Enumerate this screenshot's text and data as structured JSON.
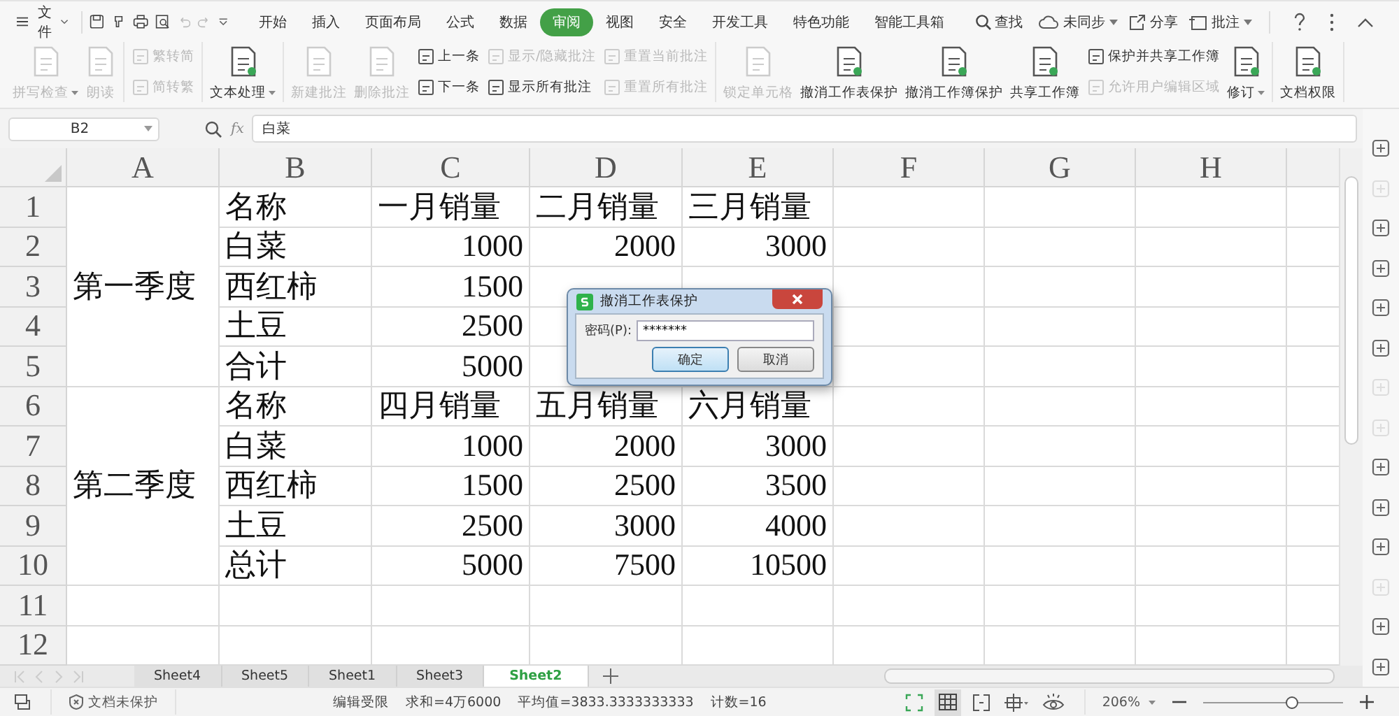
{
  "menu_bar": {
    "file": "文件",
    "tabs": [
      {
        "label": "开始",
        "selected": false
      },
      {
        "label": "插入",
        "selected": false
      },
      {
        "label": "页面布局",
        "selected": false
      },
      {
        "label": "公式",
        "selected": false
      },
      {
        "label": "数据",
        "selected": false
      },
      {
        "label": "审阅",
        "selected": true
      },
      {
        "label": "视图",
        "selected": false
      },
      {
        "label": "安全",
        "selected": false
      },
      {
        "label": "开发工具",
        "selected": false
      },
      {
        "label": "特色功能",
        "selected": false
      },
      {
        "label": "智能工具箱",
        "selected": false
      }
    ],
    "search": "查找",
    "sync": "未同步",
    "share": "分享",
    "comment": "批注"
  },
  "ribbon": [
    {
      "items": [
        {
          "kind": "big",
          "label": "拼写检查",
          "disabled": true,
          "dropdown": true
        },
        {
          "kind": "big",
          "label": "朗读",
          "disabled": true,
          "dropdown": false
        }
      ]
    },
    {
      "items": [
        {
          "kind": "stack",
          "items": [
            {
              "label": "繁转简",
              "disabled": true
            },
            {
              "label": "简转繁",
              "disabled": true
            }
          ]
        }
      ]
    },
    {
      "items": [
        {
          "kind": "big",
          "label": "文本处理",
          "disabled": false,
          "dropdown": true
        }
      ]
    },
    {
      "items": [
        {
          "kind": "big",
          "label": "新建批注",
          "disabled": true,
          "dropdown": false
        },
        {
          "kind": "big",
          "label": "删除批注",
          "disabled": true,
          "dropdown": false
        },
        {
          "kind": "stack",
          "items": [
            {
              "label": "上一条",
              "disabled": false
            },
            {
              "label": "下一条",
              "disabled": false
            }
          ]
        },
        {
          "kind": "stack",
          "items": [
            {
              "label": "显示/隐藏批注",
              "disabled": true
            },
            {
              "label": "显示所有批注",
              "disabled": false
            }
          ]
        },
        {
          "kind": "stack",
          "items": [
            {
              "label": "重置当前批注",
              "disabled": true
            },
            {
              "label": "重置所有批注",
              "disabled": true
            }
          ]
        }
      ]
    },
    {
      "items": [
        {
          "kind": "big",
          "label": "锁定单元格",
          "disabled": true,
          "dropdown": false
        },
        {
          "kind": "big",
          "label": "撤消工作表保护",
          "disabled": false,
          "dropdown": false
        },
        {
          "kind": "big",
          "label": "撤消工作簿保护",
          "disabled": false,
          "dropdown": false
        },
        {
          "kind": "big",
          "label": "共享工作簿",
          "disabled": false,
          "dropdown": false
        },
        {
          "kind": "stack",
          "items": [
            {
              "label": "保护并共享工作簿",
              "disabled": false
            },
            {
              "label": "允许用户编辑区域",
              "disabled": true
            }
          ]
        },
        {
          "kind": "big",
          "label": "修订",
          "disabled": false,
          "dropdown": true
        }
      ]
    },
    {
      "items": [
        {
          "kind": "big",
          "label": "文档权限",
          "disabled": false,
          "dropdown": false
        }
      ]
    }
  ],
  "formula_bar": {
    "cell": "B2",
    "fx": "fx",
    "value": "白菜"
  },
  "sheet": {
    "columns": [
      "A",
      "B",
      "C",
      "D",
      "E",
      "F",
      "G",
      "H"
    ],
    "groups": [
      {
        "label": "第一季度",
        "rows": [
          {
            "number": "1",
            "kind": "header",
            "b": "名称",
            "c": "一月销量",
            "d": "二月销量",
            "e": "三月销量"
          },
          {
            "number": "2",
            "kind": "data",
            "b": "白菜",
            "c": "1000",
            "d": "2000",
            "e": "3000"
          },
          {
            "number": "3",
            "kind": "data",
            "b": "西红柿",
            "c": "1500"
          },
          {
            "number": "4",
            "kind": "data",
            "b": "土豆",
            "c": "2500"
          },
          {
            "number": "5",
            "kind": "data",
            "b": "合计",
            "c": "5000"
          }
        ]
      },
      {
        "label": "第二季度",
        "rows": [
          {
            "number": "6",
            "kind": "header",
            "b": "名称",
            "c": "四月销量",
            "d": "五月销量",
            "e": "六月销量"
          },
          {
            "number": "7",
            "kind": "data",
            "b": "白菜",
            "c": "1000",
            "d": "2000",
            "e": "3000"
          },
          {
            "number": "8",
            "kind": "data",
            "b": "西红柿",
            "c": "1500",
            "d": "2500",
            "e": "3500"
          },
          {
            "number": "9",
            "kind": "data",
            "b": "土豆",
            "c": "2500",
            "d": "3000",
            "e": "4000"
          },
          {
            "number": "10",
            "kind": "data",
            "b": "总计",
            "c": "5000",
            "d": "7500",
            "e": "10500"
          }
        ]
      }
    ],
    "empty_rows": [
      {
        "number": "11"
      },
      {
        "number": "12"
      }
    ]
  },
  "dialog": {
    "title": "撤消工作表保护",
    "label": "密码(P):",
    "value": "*******",
    "buttons": [
      {
        "label": "确定",
        "selected": true
      },
      {
        "label": "取消",
        "selected": false
      }
    ]
  },
  "side_tools": [
    {
      "disabled": false
    },
    {
      "disabled": true
    },
    {
      "disabled": false
    },
    {
      "disabled": false
    },
    {
      "disabled": false
    },
    {
      "disabled": false
    },
    {
      "disabled": true
    },
    {
      "disabled": true
    },
    {
      "disabled": false
    },
    {
      "disabled": false
    },
    {
      "disabled": false
    },
    {
      "disabled": true
    },
    {
      "disabled": false
    },
    {
      "disabled": false
    }
  ],
  "sheet_tabs": [
    {
      "label": "Sheet4",
      "selected": false
    },
    {
      "label": "Sheet5",
      "selected": false
    },
    {
      "label": "Sheet1",
      "selected": false
    },
    {
      "label": "Sheet3",
      "selected": false
    },
    {
      "label": "Sheet2",
      "selected": true
    }
  ],
  "status_bar": {
    "protection": "文档未保护",
    "mode": "编辑受限",
    "sum": "求和=4万6000",
    "average": "平均值=3833.3333333333",
    "count": "计数=16",
    "zoom": "206%",
    "zoom_slider": {
      "level": 0.64
    }
  }
}
